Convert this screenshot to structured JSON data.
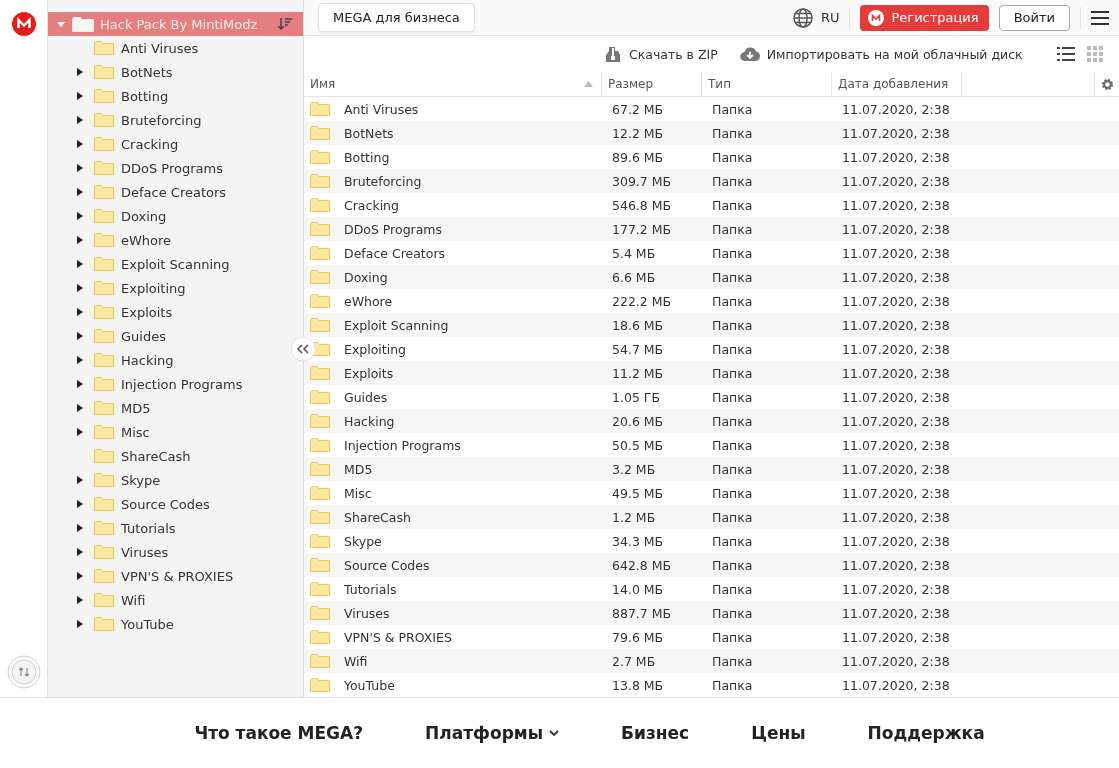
{
  "tree": {
    "label": "Hack Pack By MintiModz",
    "expanded": true,
    "selected": true,
    "children": [
      {
        "label": "Anti Viruses",
        "expandable": false
      },
      {
        "label": "BotNets",
        "expandable": true
      },
      {
        "label": "Botting",
        "expandable": true
      },
      {
        "label": "Bruteforcing",
        "expandable": true
      },
      {
        "label": "Cracking",
        "expandable": true
      },
      {
        "label": "DDoS Programs",
        "expandable": true
      },
      {
        "label": "Deface Creators",
        "expandable": true
      },
      {
        "label": "Doxing",
        "expandable": true
      },
      {
        "label": "eWhore",
        "expandable": true
      },
      {
        "label": "Exploit Scanning",
        "expandable": true
      },
      {
        "label": "Exploiting",
        "expandable": true
      },
      {
        "label": "Exploits",
        "expandable": true
      },
      {
        "label": "Guides",
        "expandable": true
      },
      {
        "label": "Hacking",
        "expandable": true
      },
      {
        "label": "Injection Programs",
        "expandable": true
      },
      {
        "label": "MD5",
        "expandable": true
      },
      {
        "label": "Misc",
        "expandable": true
      },
      {
        "label": "ShareCash",
        "expandable": false
      },
      {
        "label": "Skype",
        "expandable": true
      },
      {
        "label": "Source Codes",
        "expandable": true
      },
      {
        "label": "Tutorials",
        "expandable": true
      },
      {
        "label": "Viruses",
        "expandable": true
      },
      {
        "label": "VPN'S & PROXIES",
        "expandable": true
      },
      {
        "label": "Wifi",
        "expandable": true
      },
      {
        "label": "YouTube",
        "expandable": true
      }
    ]
  },
  "topbar": {
    "business_button": "MEGA для бизнеса",
    "language": "RU",
    "register_button": "Регистрация",
    "login_button": "Войти"
  },
  "toolbar": {
    "download": "Скачать в ZIP",
    "import": "Импортировать на мой облачный диск",
    "view_buttons": [
      {
        "kind": "list",
        "selected": true
      },
      {
        "kind": "grid",
        "selected": false
      }
    ]
  },
  "table": {
    "columns": [
      {
        "label": "Имя",
        "sorted": true
      },
      {
        "label": "Размер",
        "sorted": false
      },
      {
        "label": "Тип",
        "sorted": false
      },
      {
        "label": "Дата добавления",
        "sorted": false
      }
    ],
    "rows": [
      [
        "Anti Viruses",
        "67.2 МБ",
        "Папка",
        "11.07.2020, 2:38"
      ],
      [
        "BotNets",
        "12.2 МБ",
        "Папка",
        "11.07.2020, 2:38"
      ],
      [
        "Botting",
        "89.6 МБ",
        "Папка",
        "11.07.2020, 2:38"
      ],
      [
        "Bruteforcing",
        "309.7 МБ",
        "Папка",
        "11.07.2020, 2:38"
      ],
      [
        "Cracking",
        "546.8 МБ",
        "Папка",
        "11.07.2020, 2:38"
      ],
      [
        "DDoS Programs",
        "177.2 МБ",
        "Папка",
        "11.07.2020, 2:38"
      ],
      [
        "Deface Creators",
        "5.4 МБ",
        "Папка",
        "11.07.2020, 2:38"
      ],
      [
        "Doxing",
        "6.6 МБ",
        "Папка",
        "11.07.2020, 2:38"
      ],
      [
        "eWhore",
        "222.2 МБ",
        "Папка",
        "11.07.2020, 2:38"
      ],
      [
        "Exploit Scanning",
        "18.6 МБ",
        "Папка",
        "11.07.2020, 2:38"
      ],
      [
        "Exploiting",
        "54.7 МБ",
        "Папка",
        "11.07.2020, 2:38"
      ],
      [
        "Exploits",
        "11.2 МБ",
        "Папка",
        "11.07.2020, 2:38"
      ],
      [
        "Guides",
        "1.05 ГБ",
        "Папка",
        "11.07.2020, 2:38"
      ],
      [
        "Hacking",
        "20.6 МБ",
        "Папка",
        "11.07.2020, 2:38"
      ],
      [
        "Injection Programs",
        "50.5 МБ",
        "Папка",
        "11.07.2020, 2:38"
      ],
      [
        "MD5",
        "3.2 МБ",
        "Папка",
        "11.07.2020, 2:38"
      ],
      [
        "Misc",
        "49.5 МБ",
        "Папка",
        "11.07.2020, 2:38"
      ],
      [
        "ShareCash",
        "1.2 МБ",
        "Папка",
        "11.07.2020, 2:38"
      ],
      [
        "Skype",
        "34.3 МБ",
        "Папка",
        "11.07.2020, 2:38"
      ],
      [
        "Source Codes",
        "642.8 МБ",
        "Папка",
        "11.07.2020, 2:38"
      ],
      [
        "Tutorials",
        "14.0 МБ",
        "Папка",
        "11.07.2020, 2:38"
      ],
      [
        "Viruses",
        "887.7 МБ",
        "Папка",
        "11.07.2020, 2:38"
      ],
      [
        "VPN'S & PROXIES",
        "79.6 МБ",
        "Папка",
        "11.07.2020, 2:38"
      ],
      [
        "Wifi",
        "2.7 МБ",
        "Папка",
        "11.07.2020, 2:38"
      ],
      [
        "YouTube",
        "13.8 МБ",
        "Папка",
        "11.07.2020, 2:38"
      ]
    ]
  },
  "footer": {
    "links": [
      {
        "label": "Что такое MEGA?",
        "dropdown": false
      },
      {
        "label": "Платформы",
        "dropdown": true
      },
      {
        "label": "Бизнес",
        "dropdown": false
      },
      {
        "label": "Цены",
        "dropdown": false
      },
      {
        "label": "Поддержка",
        "dropdown": false
      }
    ]
  }
}
